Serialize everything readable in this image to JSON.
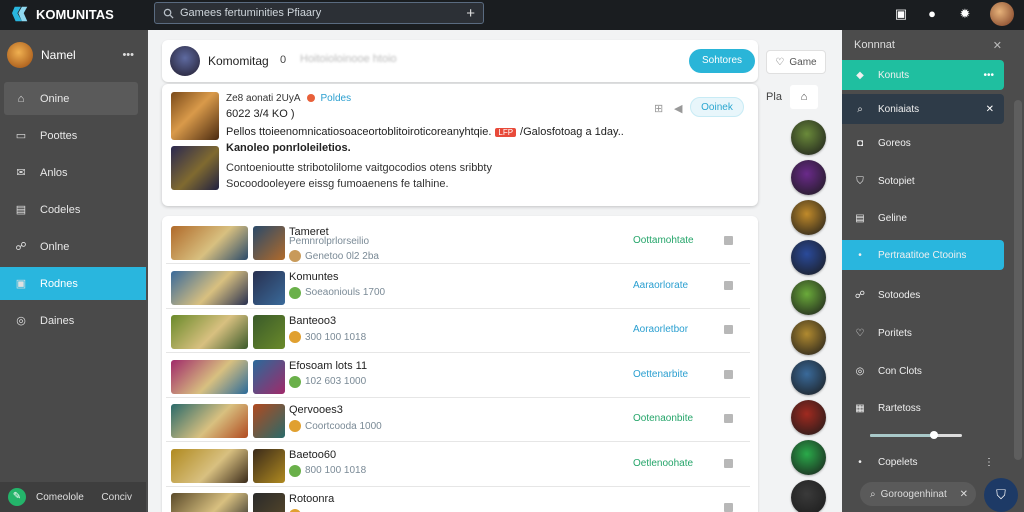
{
  "brand": {
    "name": "KOMUNITAS"
  },
  "search": {
    "value": "Gamees fertuminities Pfiaary"
  },
  "top_icons": [
    "mobile-icon",
    "notification-icon",
    "settings-icon",
    "user-avatar"
  ],
  "sidebar": {
    "user_name": "Namel",
    "items": [
      {
        "label": "Onine",
        "icon": "home-icon",
        "state": "hover"
      },
      {
        "label": "Poottes",
        "icon": "chat-icon"
      },
      {
        "label": "Anlos",
        "icon": "mail-icon"
      },
      {
        "label": "Codeles",
        "icon": "book-icon"
      },
      {
        "label": "Onlne",
        "icon": "people-icon"
      },
      {
        "label": "Rodnes",
        "icon": "monitor-icon",
        "state": "active"
      },
      {
        "label": "Daines",
        "icon": "globe-icon"
      }
    ],
    "footer": {
      "label": "Comeolole",
      "right": "Conciv"
    }
  },
  "profile_header": {
    "title": "Komomitag",
    "zero": "0",
    "blurred": "Hoitoioloinooe   htoio",
    "primary_button": "Sohtores",
    "game_button": "Game"
  },
  "post": {
    "meta": "Ze8 aonati 2UyA",
    "tag": "Poldes",
    "subline": "6022 3/4 KO  )",
    "line1": "Pellos ttoieenomnicatiosoaceortoblitoiroticoreanyhtqie.",
    "badge": "LFP",
    "line1_tail": "/Galosfotoag a 1day..",
    "line2": "Kanoleo ponrloleiletios.",
    "line3": "Contoenioutte stribotolilome vaitgocodios otens sribbty",
    "line4": "Socoodooleyere eissg fumoaenens fe talhine.",
    "online_button": "Ooinek"
  },
  "toolbar": {
    "t1": "Pla",
    "t2": "⌂"
  },
  "list": [
    {
      "title": "Tameret",
      "sub1": "Pemnrolprlorseilio",
      "sub2": "Genetoo 0l2 2ba",
      "action": "Oottamohtate",
      "action_color": "green",
      "c1": "#b06a2a",
      "c2": "#2a4a6a"
    },
    {
      "title": "Komuntes",
      "sub": "Soeaoniouls 1700",
      "action": "Aaraorlorate",
      "action_color": "blue",
      "c1": "#3a6a9a",
      "c2": "#283050"
    },
    {
      "title": "Banteoo3",
      "sub": "300 100 1018",
      "action": "Aoraorletbor",
      "action_color": "blue",
      "c1": "#6a8a2a",
      "c2": "#3a5a2a"
    },
    {
      "title": "Efosoam lots 11",
      "sub": "102 603 1000",
      "action": "Oettenarbite",
      "action_color": "blue",
      "c1": "#a02a6a",
      "c2": "#2a6a9a"
    },
    {
      "title": "Qervooes3",
      "sub": "Coortcooda 1000",
      "action": "Ootenaonbite",
      "action_color": "green",
      "c1": "#2a6a6a",
      "c2": "#b04a20"
    },
    {
      "title": "Baetoo60",
      "sub": "800 100 1018",
      "action": "Oetlenoohate",
      "action_color": "green",
      "c1": "#b08a20",
      "c2": "#3a2a1a"
    },
    {
      "title": "Rotoonra",
      "sub": "",
      "action": "",
      "action_color": "green",
      "c1": "#5a4a2a",
      "c2": "#2a2a2a"
    }
  ],
  "rail": [
    "#6a8a3a",
    "#6a2a8a",
    "#c08a2a",
    "#2a4a9a",
    "#6aaa3a",
    "#b08a30",
    "#3a6a9a",
    "#a02a20",
    "#2aaa4a",
    "#3a3a3a"
  ],
  "right_panel": {
    "header": "Konnnat",
    "items": [
      {
        "label": "Konuts",
        "icon": "logo-icon",
        "style": "teal",
        "right": "•••"
      },
      {
        "label": "Koniaiats",
        "icon": "search-icon",
        "style": "dark",
        "right": "✕"
      },
      {
        "label": "Goreos",
        "icon": "gamepad-icon"
      },
      {
        "label": "Sotopiet",
        "icon": "shield-icon"
      },
      {
        "label": "Geline",
        "icon": "doc-icon"
      },
      {
        "label": "Pertraatitoe Ctooins",
        "icon": "dot-icon",
        "style": "blue"
      },
      {
        "label": "Sotoodes",
        "icon": "people-icon"
      },
      {
        "label": "Poritets",
        "icon": "heart-icon"
      },
      {
        "label": "Con Clots",
        "icon": "circle-icon"
      },
      {
        "label": "Rartetoss",
        "icon": "chart-icon"
      },
      {
        "label": "Copelets",
        "icon": "dot-icon",
        "right": "⋮"
      }
    ],
    "slider_value": 0.7,
    "search_text": "Goroogenhinat"
  },
  "colors": {
    "accent": "#29b6de",
    "teal": "#1fbfa0",
    "green": "#25a56a"
  }
}
